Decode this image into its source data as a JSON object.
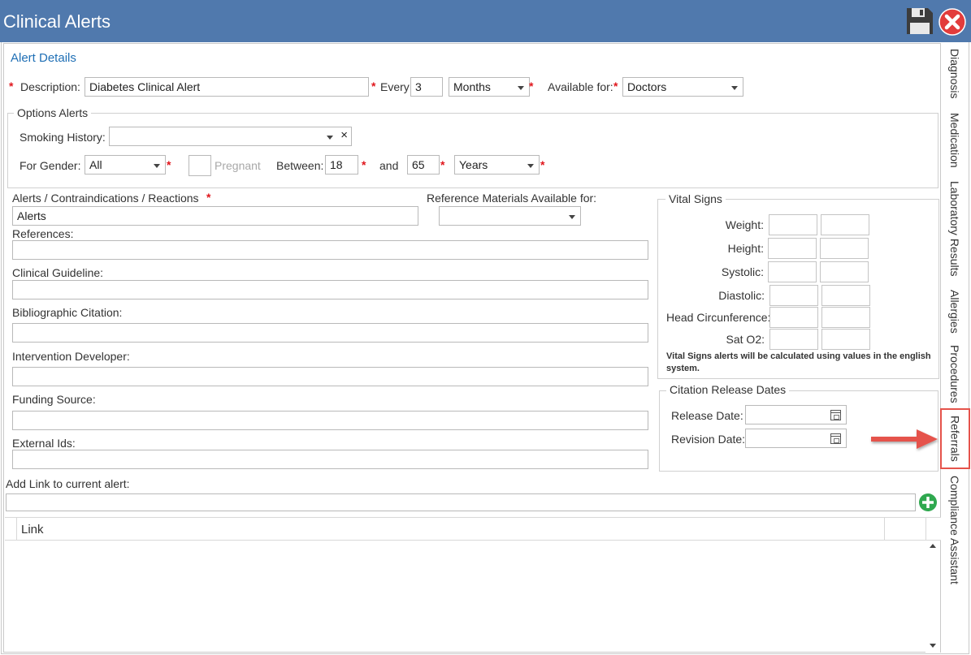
{
  "window": {
    "title": "Clinical Alerts"
  },
  "alert_details": {
    "heading": "Alert Details",
    "description_label": "Description:",
    "description_value": "Diabetes Clinical Alert",
    "every_label": "Every:",
    "every_value": "3",
    "period_value": "Months",
    "available_label": "Available for:",
    "available_value": "Doctors",
    "required_mark": "*"
  },
  "options": {
    "title": "Options Alerts",
    "smoking_label": "Smoking History:",
    "smoking_value": "",
    "clear_glyph": "×",
    "gender_label": "For Gender:",
    "gender_value": "All",
    "pregnant_label": "Pregnant",
    "between_label": "Between:",
    "between_from": "18",
    "and_label": "and",
    "between_to": "65",
    "age_unit": "Years"
  },
  "fields": {
    "alerts_label": "Alerts / Contraindications / Reactions",
    "alerts_value": "Alerts",
    "ref_materials_label": "Reference Materials Available for:",
    "ref_materials_value": "",
    "references_label": "References:",
    "guideline_label": "Clinical Guideline:",
    "citation_label": "Bibliographic Citation:",
    "developer_label": "Intervention Developer:",
    "funding_label": "Funding Source:",
    "external_label": "External Ids:"
  },
  "vital_signs": {
    "title": "Vital Signs",
    "rows": [
      "Weight:",
      "Height:",
      "Systolic:",
      "Diastolic:",
      "Head Circunference:",
      "Sat O2:"
    ],
    "note": "Vital Signs alerts will be calculated using values in the english system."
  },
  "citation_dates": {
    "title": "Citation Release Dates",
    "release_label": "Release Date:",
    "revision_label": "Revision Date:"
  },
  "links": {
    "add_label": "Add Link to current alert:",
    "column_header": "Link"
  },
  "side_tabs": [
    "Diagnosis",
    "Medication",
    "Laboratory Results",
    "Allergies",
    "Procedures",
    "Referrals",
    "Compliance Assistant"
  ],
  "icons": {
    "save": "floppy-disk-icon",
    "close": "close-icon",
    "add": "add-circle-icon",
    "calendar": "calendar-icon"
  },
  "colors": {
    "titlebar": "#5079ad",
    "accent_text": "#1f6fb5",
    "required": "#e0161c",
    "annotation": "#e5534b",
    "add_button": "#2fa84f"
  }
}
